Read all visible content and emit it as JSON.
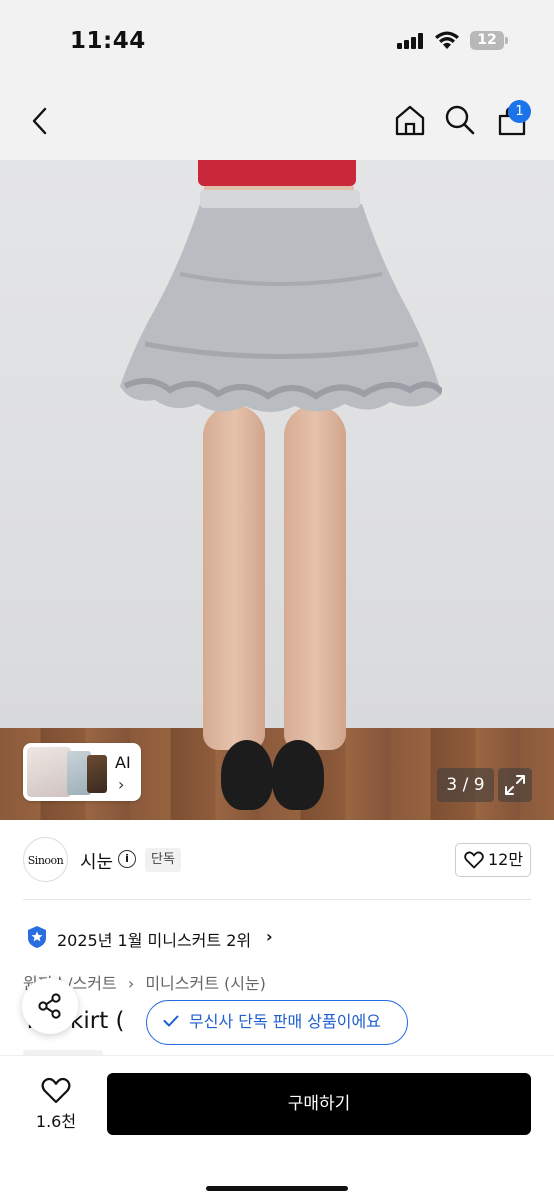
{
  "status_bar": {
    "time": "11:44",
    "battery": "12"
  },
  "nav": {
    "back_icon": "chevron-left-icon",
    "home_icon": "home-icon",
    "search_icon": "search-icon",
    "cart_icon": "shopping-bag-icon",
    "cart_badge": "1",
    "badge_color": "#1a73e8"
  },
  "gallery": {
    "ai_label": "AI",
    "ai_chevron": "›",
    "counter": "3 / 9",
    "expand_icon": "expand-icon"
  },
  "brand": {
    "logo_text": "Sinoon",
    "name": "시눈",
    "info_icon": "i",
    "tag": "단독",
    "like_count": "12만"
  },
  "ranking": {
    "text": "2025년 1월 미니스커트 2위",
    "chevron": "›",
    "badge_color": "#2a6de0"
  },
  "breadcrumb": {
    "items": [
      "원피스/스커트",
      "미니스커트 (시눈)"
    ],
    "separator": "›"
  },
  "product": {
    "title_visible": "Tu  Skirt (",
    "tooltip": "무신사 단독 판매 상품이에요"
  },
  "bottom_bar": {
    "like_count": "1.6천",
    "buy_label": "구매하기"
  }
}
